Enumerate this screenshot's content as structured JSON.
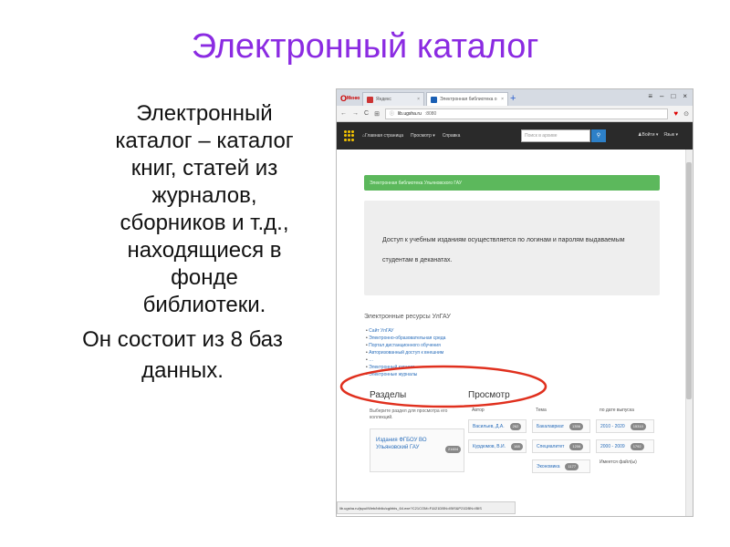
{
  "slide": {
    "title": "Электронный каталог",
    "para1_lines": [
      "Электронный",
      "каталог – каталог",
      "книг, статей из",
      "журналов,",
      "сборников и т.д.,",
      "находящиеся в",
      "фонде",
      "библиотеки."
    ],
    "para2_lines": [
      "Он состоит из 8 баз",
      "данных."
    ],
    "title_color": "#8b2be2"
  },
  "browser": {
    "app_label": "Меню",
    "tabs": [
      {
        "label": "Яндекс",
        "state": "inactive"
      },
      {
        "label": "Электронная библиотека о",
        "state": "active"
      }
    ],
    "address": "lib.ugsha.ru",
    "address_path": ":8080",
    "status_url": "lib.ugsha.ru/jspui/Web/biblio/cgiirbis_64.exe?C21COM=F&I21DBN=IBIS&P21DBN=IBIS"
  },
  "site": {
    "nav": {
      "home": "Главная страница",
      "browse": "Просмотр ▾",
      "help": "Справка",
      "search_placeholder": "Поиск в архиве",
      "login": "Войти ▾",
      "lang": "Язык ▾"
    },
    "breadcrumb": "Электронная библиотека Ульяновского ГАУ",
    "notice_line1": "Доступ к учебным изданиям осуществляется по логинам и паролям выдаваемым",
    "notice_line2": "студентам в деканатах.",
    "resources_title": "Электронные ресурсы УлГАУ",
    "resources": [
      "Сайт УлГАУ",
      "Электронно-образовательная среда",
      "Портал дистанционного обучения",
      "Авторизованный доступ к внешним",
      "…",
      "Электронный каталог",
      "Электронные журналы"
    ],
    "sections_title": "Разделы",
    "sections_desc": "Выберите раздел для просмотра его коллекций.",
    "section_item": "Издания ФГБОУ ВО Ульяновский ГАУ",
    "section_count": "21604",
    "browse_title": "Просмотр",
    "columns": [
      {
        "head": "Автор",
        "items": [
          {
            "label": "Васильев, Д.А.",
            "count": "262"
          },
          {
            "label": "Курдюмов, В.И.",
            "count": "168"
          }
        ]
      },
      {
        "head": "Тема",
        "items": [
          {
            "label": "Бакалавриат",
            "count": "1356"
          },
          {
            "label": "Специалитет",
            "count": "1206"
          },
          {
            "label": "Экономика",
            "count": "1177"
          }
        ]
      },
      {
        "head": "по дате выпуска",
        "items": [
          {
            "label": "2010 - 2020",
            "count": "15310"
          },
          {
            "label": "2000 - 2009",
            "count": "1792"
          }
        ],
        "footer": "Имеется файл(ы)"
      }
    ]
  },
  "colors": {
    "green_bar": "#5cb85c",
    "navbar": "#2a2a2a",
    "highlight_oval": "#e0301e"
  }
}
